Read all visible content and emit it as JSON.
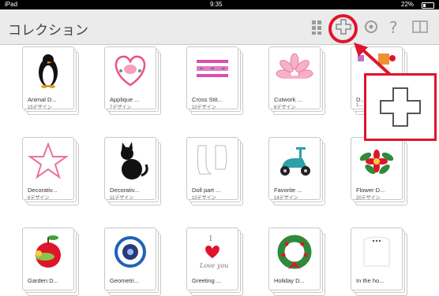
{
  "status": {
    "device": "iPad",
    "time": "9:35",
    "battery": "22%"
  },
  "nav": {
    "title": "コレクション",
    "icons": [
      "grid-icon",
      "plus-icon",
      "settings-icon",
      "help-icon",
      "book-icon"
    ]
  },
  "collections": [
    {
      "label": "Animal D...",
      "count": "15デザイン",
      "thumb": "penguin"
    },
    {
      "label": "Applique ...",
      "count": "7デザイン",
      "thumb": "heart"
    },
    {
      "label": "Cross Stit...",
      "count": "10デザイン",
      "thumb": "cross-stitch"
    },
    {
      "label": "Cutwork ...",
      "count": "6デザイン",
      "thumb": "flower-pink"
    },
    {
      "label": "D...",
      "count": "1...",
      "thumb": "decor"
    },
    {
      "label": "Decorativ...",
      "count": "6デザイン",
      "thumb": "star"
    },
    {
      "label": "Decorativ...",
      "count": "11デザイン",
      "thumb": "cat"
    },
    {
      "label": "Doll part ...",
      "count": "10デザイン",
      "thumb": "doll"
    },
    {
      "label": "Favorite ...",
      "count": "14デザイン",
      "thumb": "scooter"
    },
    {
      "label": "Flower D...",
      "count": "20デザイン",
      "thumb": "flower"
    },
    {
      "label": "Garden D...",
      "count": "",
      "thumb": "apple"
    },
    {
      "label": "Geometri...",
      "count": "",
      "thumb": "geometric"
    },
    {
      "label": "Greeting ...",
      "count": "",
      "thumb": "greeting"
    },
    {
      "label": "Holiday D...",
      "count": "",
      "thumb": "wreath"
    },
    {
      "label": "In the ho...",
      "count": "",
      "thumb": "home"
    }
  ],
  "greeting_text": {
    "line1": "I",
    "line2": "Love you"
  },
  "colors": {
    "accent": "#e0142b",
    "navbar": "#ebebeb"
  }
}
